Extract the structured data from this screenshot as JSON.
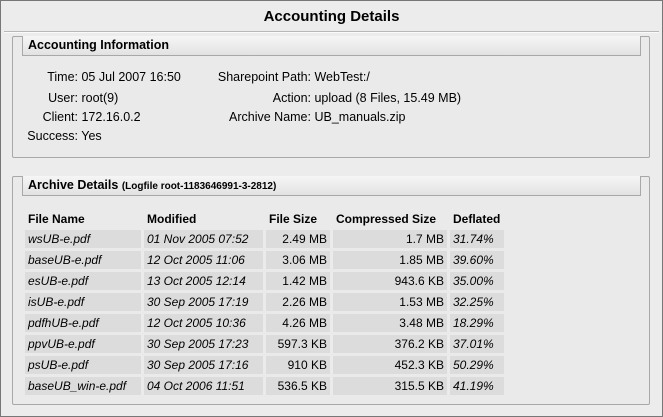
{
  "window": {
    "title": "Accounting Details"
  },
  "accounting": {
    "heading": "Accounting Information",
    "time": {
      "label": "Time:",
      "value": "05 Jul 2007 16:50"
    },
    "user": {
      "label": "User:",
      "value": "root(9)"
    },
    "client": {
      "label": "Client:",
      "value": "172.16.0.2"
    },
    "success": {
      "label": "Success:",
      "value": "Yes"
    },
    "sharepoint_path": {
      "label": "Sharepoint Path:",
      "value": "WebTest:/"
    },
    "action": {
      "label": "Action:",
      "value": "upload (8 Files, 15.49 MB)"
    },
    "archive_name": {
      "label": "Archive Name:",
      "value": "UB_manuals.zip"
    }
  },
  "archive": {
    "heading": "Archive Details",
    "logfile": "(Logfile root-1183646991-3-2812)",
    "columns": [
      "File Name",
      "Modified",
      "File Size",
      "Compressed Size",
      "Deflated"
    ],
    "rows": [
      [
        "wsUB-e.pdf",
        "01 Nov 2005 07:52",
        "2.49 MB",
        "1.7 MB",
        "31.74%"
      ],
      [
        "baseUB-e.pdf",
        "12 Oct 2005 11:06",
        "3.06 MB",
        "1.85 MB",
        "39.60%"
      ],
      [
        "esUB-e.pdf",
        "13 Oct 2005 12:14",
        "1.42 MB",
        "943.6 KB",
        "35.00%"
      ],
      [
        "isUB-e.pdf",
        "30 Sep 2005 17:19",
        "2.26 MB",
        "1.53 MB",
        "32.25%"
      ],
      [
        "pdfhUB-e.pdf",
        "12 Oct 2005 10:36",
        "4.26 MB",
        "3.48 MB",
        "18.29%"
      ],
      [
        "ppvUB-e.pdf",
        "30 Sep 2005 17:23",
        "597.3 KB",
        "376.2 KB",
        "37.01%"
      ],
      [
        "psUB-e.pdf",
        "30 Sep 2005 17:16",
        "910 KB",
        "452.3 KB",
        "50.29%"
      ],
      [
        "baseUB_win-e.pdf",
        "04 Oct 2006 11:51",
        "536.5 KB",
        "315.5 KB",
        "41.19%"
      ]
    ]
  }
}
